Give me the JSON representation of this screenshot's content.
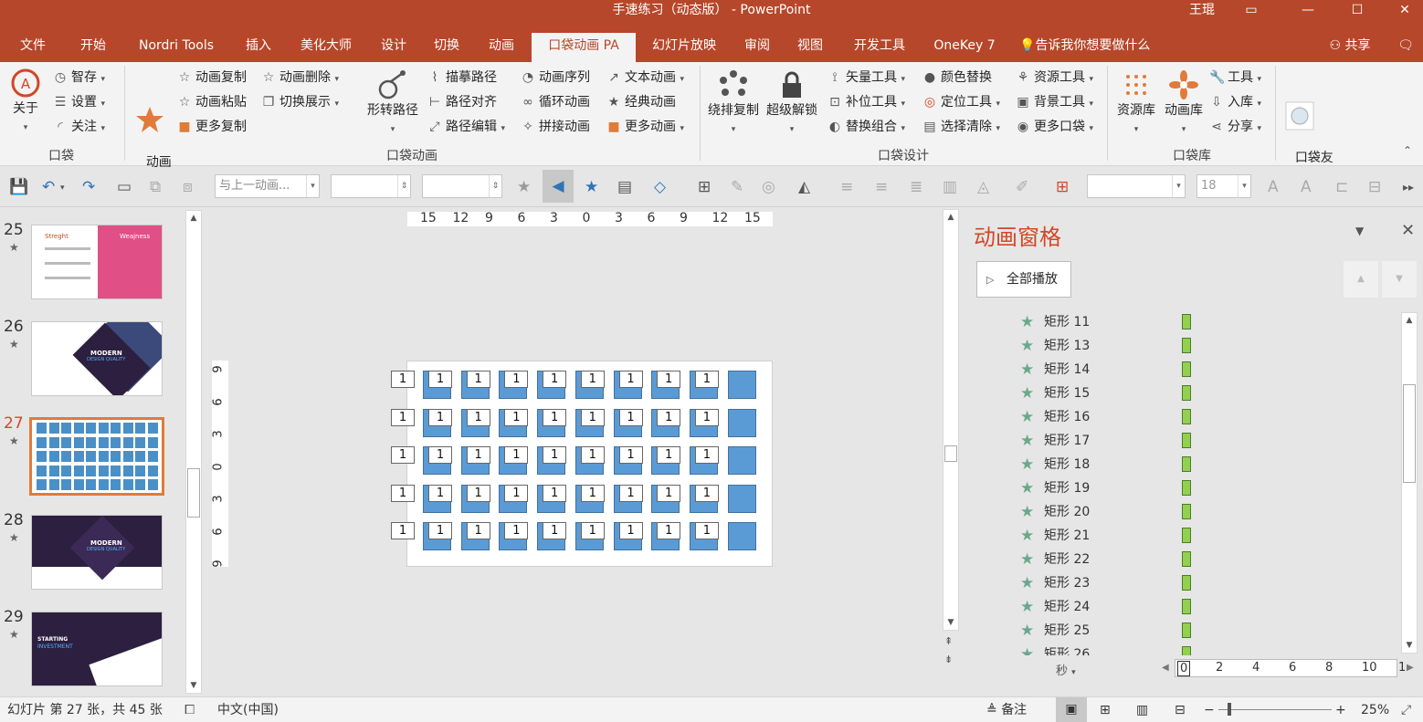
{
  "window": {
    "title": "手速练习（动态版） - PowerPoint",
    "user": "王琨"
  },
  "tabs": [
    "文件",
    "开始",
    "Nordri Tools",
    "插入",
    "美化大师",
    "设计",
    "切换",
    "动画",
    "口袋动画 PA",
    "幻灯片放映",
    "审阅",
    "视图",
    "开发工具",
    "OneKey 7"
  ],
  "active_tab": "口袋动画 PA",
  "tell_me": "告诉我你想要做什么",
  "share": "共享",
  "ribbon": {
    "group_pocket": {
      "label": "口袋",
      "about": "关于",
      "items": [
        "智存",
        "设置",
        "关注"
      ]
    },
    "group_anim": {
      "label": "口袋动画",
      "scenery": "动画\n风暴",
      "col1": [
        "动画复制",
        "动画粘贴",
        "更多复制"
      ],
      "col2": [
        "动画删除",
        "切换展示"
      ],
      "shape_path": "形转路径",
      "col3": [
        "描摹路径",
        "路径对齐",
        "路径编辑"
      ],
      "col4": [
        "动画序列",
        "循环动画",
        "拼接动画"
      ],
      "col5": [
        "文本动画",
        "经典动画",
        "更多动画"
      ]
    },
    "group_design": {
      "label": "口袋设计",
      "orbit": "绕排复制",
      "unlock": "超级解锁",
      "col1": [
        "矢量工具",
        "补位工具",
        "替换组合"
      ],
      "col2": [
        "颜色替换",
        "定位工具",
        "选择清除"
      ],
      "col3": [
        "资源工具",
        "背景工具",
        "更多口袋"
      ]
    },
    "group_lib": {
      "label": "口袋库",
      "resource": "资源库",
      "animlib": "动画库",
      "col": [
        "工具",
        "入库",
        "分享"
      ]
    },
    "friends": "口袋友\n情"
  },
  "toolbar": {
    "trigger_placeholder": "与上一动画...",
    "font_size": "18"
  },
  "thumbnails": [
    {
      "num": "25",
      "title": "Streght",
      "title2": "Weajness"
    },
    {
      "num": "26",
      "title": "MODERN",
      "title2": "DESIGN QUALITY"
    },
    {
      "num": "27",
      "title": "",
      "title2": ""
    },
    {
      "num": "28",
      "title": "MODERN",
      "title2": "DESIGN QUALITY"
    },
    {
      "num": "29",
      "title": "STARTING",
      "title2": "INVESTMENT"
    }
  ],
  "rulers": {
    "horizontal": [
      "15",
      "12",
      "9",
      "6",
      "3",
      "0",
      "3",
      "6",
      "9",
      "12",
      "15"
    ],
    "vertical": [
      "9",
      "6",
      "3",
      "0",
      "3",
      "6",
      "9"
    ]
  },
  "slide": {
    "cell_label": "1"
  },
  "pane": {
    "title": "动画窗格",
    "play_all": "全部播放",
    "items": [
      "矩形 11",
      "矩形 13",
      "矩形 14",
      "矩形 15",
      "矩形 16",
      "矩形 17",
      "矩形 18",
      "矩形 19",
      "矩形 20",
      "矩形 21",
      "矩形 22",
      "矩形 23",
      "矩形 24",
      "矩形 25",
      "矩形 26"
    ],
    "time_unit": "秒",
    "timeline_ticks": [
      "0",
      "2",
      "4",
      "6",
      "8",
      "10",
      "1"
    ]
  },
  "status": {
    "slide_info": "幻灯片 第 27 张，共 45 张",
    "language": "中文(中国)",
    "notes": "备注",
    "zoom": "25%"
  },
  "colors": {
    "brand": "#b7472a",
    "cell_fill": "#5b9bd5",
    "anim_bar": "#92d050",
    "pane_title": "#d24726"
  }
}
